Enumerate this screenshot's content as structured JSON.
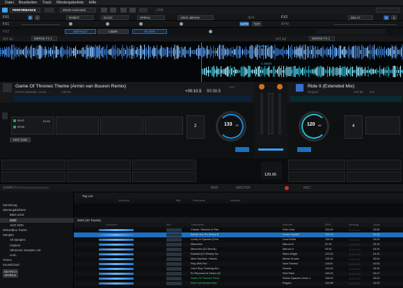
{
  "menu": [
    "Datei",
    "Bearbeiten",
    "Track",
    "Wiedergabeliste",
    "Hilfe"
  ],
  "topbar": {
    "mode": "PERFORMANCE",
    "layout": "2Deck Horizontal",
    "link": "LINK"
  },
  "fx": {
    "fx1_label": "FX1",
    "fx2_label": "FX2",
    "fx1_effects": [
      "ROBOT",
      "ECHO",
      "SPIRAL",
      "VINYL BRAKE"
    ],
    "fx2_effects": [
      "DELAY"
    ],
    "fx1_send": "FX1",
    "fx2_send": "FX2",
    "auto": "AUTO",
    "tap": "TAP",
    "default": "DEFAULT",
    "user": "USER",
    "filter": "FILTER",
    "sfx": "SFX",
    "bpm": "BPM"
  },
  "mix_row": {
    "left_label": "INT A1",
    "left_select": "MERGE FX 1",
    "right_label": "INT A2",
    "right_select": "MERGE FX 1"
  },
  "deck1": {
    "title": "Game Of Thrones Theme (Armin van Buuren Remix)",
    "artist": "Ramin Djawadi, Armin ...",
    "bpm": "138.00",
    "elapsed": "+00:10.5",
    "remain": "00:30.5",
    "key_label": "KEY",
    "tempo_display": "133",
    "tempo_decimal": ".18",
    "hotcue": "HOT CUE",
    "beatjump": "2",
    "cue_labels": [
      "00:07",
      "00:06",
      "01:24"
    ],
    "wave_marker": "220.4Bars"
  },
  "deck2": {
    "title": "Ride It (Extended Mix)",
    "artist": "Regard",
    "bpm": "120.88",
    "key": "Gm",
    "tempo_display": "120",
    "tempo_decimal": ".88",
    "beatjump": "4",
    "wave_marker": "1.1Bars"
  },
  "mixer": {
    "master_bpm": "120.00",
    "master_label": "MASTER"
  },
  "transport": {
    "rec": "REC",
    "midi": "MIDI",
    "samples_label": "SAMPLE"
  },
  "browser": {
    "tree": [
      {
        "label": "Sammlung",
        "indent": 0
      },
      {
        "label": "Wiedergabelisten",
        "indent": 0
      },
      {
        "label": "BMG 2019",
        "indent": 1
      },
      {
        "label": "2020",
        "indent": 1,
        "selected": true
      },
      {
        "label": "Jetzt 2020",
        "indent": 1
      },
      {
        "label": "Rekordbox Tracks",
        "indent": 0
      },
      {
        "label": "Sampler",
        "indent": 0
      },
      {
        "label": "All Samples",
        "indent": 1
      },
      {
        "label": "Capture",
        "indent": 1
      },
      {
        "label": "Ultrasonic Sampler List",
        "indent": 1
      },
      {
        "label": "Lied...",
        "indent": 1
      },
      {
        "label": "iTunes",
        "indent": 0
      },
      {
        "label": "SoundCloud",
        "indent": 0
      },
      {
        "label": "Beatport",
        "indent": 0
      },
      {
        "label": "Beatsource",
        "indent": 0
      }
    ],
    "search": "SEARCH",
    "mobile": "MOBILE",
    "taglist": "Tag List",
    "playlist_title": "2020 (20 Tracks)",
    "columns": [
      "Vorschau",
      "Bild",
      "Trackname",
      "Interpret",
      "Album",
      "Genre",
      "BPM",
      "Wertung",
      "Dauer"
    ],
    "rows": [
      {
        "title": "Crease, Ramirez & Ran",
        "artist": "Feliz Cent",
        "bpm": "124.00",
        "time": "03:59"
      },
      {
        "title": "Before You Go (Pains B",
        "artist": "Lewis Capaldi",
        "bpm": "120.00",
        "time": "03:46",
        "selected": true
      },
      {
        "title": "Lovely in Spanien (Fest",
        "artist": "Luca Bulba",
        "bpm": "128.00",
        "time": "03:26"
      },
      {
        "title": "Memories",
        "artist": "Maroon 5",
        "bpm": "91.00",
        "time": "03:10"
      },
      {
        "title": "Memories (DJ Remix)",
        "artist": "Maroon 5",
        "bpm": "93.00",
        "time": "03:34"
      },
      {
        "title": "Ramadi (DJ Wesley Sa",
        "artist": "Mans Wright",
        "bpm": "123.00",
        "time": "04:10"
      },
      {
        "title": "Mein Nachbar / Nachb",
        "artist": "Mickie Krause",
        "bpm": "128.00",
        "time": "03:04"
      },
      {
        "title": "Play With Fire",
        "artist": "Sam Tinnesz",
        "bpm": "118.00",
        "time": "02:53"
      },
      {
        "title": "Can't Stop Thinking Abo",
        "artist": "Dzeeta",
        "bpm": "124.00",
        "time": "03:32"
      },
      {
        "title": "Ex Reprend Im Karton (G",
        "artist": "Pink Paris",
        "bpm": "126.00",
        "time": "03:47"
      },
      {
        "title": "Game Of Thrones Them",
        "artist": "Ramin Djawadi, Armin v",
        "bpm": "138.00",
        "time": "05:20"
      },
      {
        "title": "Ride It (Extended Mix)",
        "artist": "Regard",
        "bpm": "120.88",
        "time": "04:29"
      }
    ]
  },
  "colors": {
    "accent": "#3da3ff",
    "deck1": "#1f8fe0",
    "deck2": "#1fc2d8",
    "bg": "#0b0c0d"
  },
  "icons": {
    "settings": "gear-icon",
    "mixer": "mixer-icon",
    "search": "search-icon"
  }
}
